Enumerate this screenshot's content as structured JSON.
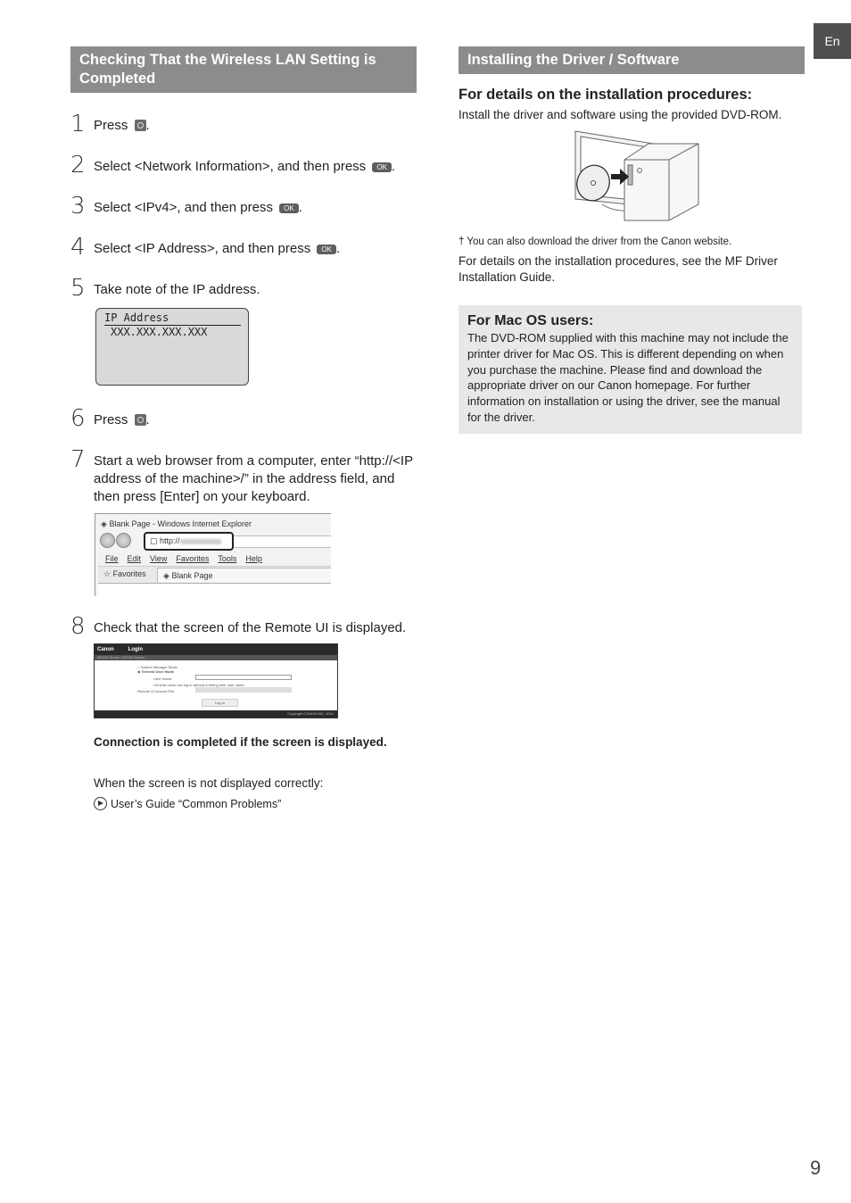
{
  "lang_tab": "En",
  "page_number": "9",
  "left": {
    "header": "Checking That the Wireless LAN Setting is Completed",
    "steps": [
      {
        "num": "1",
        "pre": "Press",
        "post": ".",
        "button": "home-button"
      },
      {
        "num": "2",
        "pre": "Select <Network Information>, and then press",
        "post": ".",
        "button": "OK"
      },
      {
        "num": "3",
        "pre": "Select <IPv4>, and then press",
        "post": ".",
        "button": "OK"
      },
      {
        "num": "4",
        "pre": "Select <IP Address>, and then press",
        "post": ".",
        "button": "OK"
      },
      {
        "num": "5",
        "text": "Take note of the IP address."
      },
      {
        "num": "6",
        "pre": "Press",
        "post": ".",
        "button": "home-button"
      },
      {
        "num": "7",
        "text": "Start a web browser from a computer, enter “http://<IP address of the machine>/” in the address field, and then press [Enter] on your keyboard."
      },
      {
        "num": "8",
        "text": "Check that the screen of the Remote UI is displayed."
      }
    ],
    "ok_label": "OK",
    "lcd": {
      "title": "IP Address",
      "value": "XXX.XXX.XXX.XXX"
    },
    "browser": {
      "title": "Blank Page - Windows Internet Explorer",
      "address": "http://",
      "menu": [
        "File",
        "Edit",
        "View",
        "Favorites",
        "Tools",
        "Help"
      ],
      "favorites": "Favorites",
      "tab": "Blank Page"
    },
    "remote_ui": {
      "brand": "Canon",
      "title": "Login",
      "crumb": "MF240 Series / MF240 Series /",
      "mode1": "System Manager Mode",
      "mode2": "General User Mode",
      "user_name_label": "User Name:",
      "note": "General users can log in without entering their user name.",
      "pin_label": "Remote UI Access PIN:",
      "login_button": "Log In",
      "copyright": "Copyright CANON INC. 2014"
    },
    "bold_note": "Connection is completed if the screen is displayed.",
    "plain_note": "When the screen is not displayed correctly:",
    "reference": "User’s Guide “Common Problems”"
  },
  "right": {
    "header": "Installing the Driver / Software",
    "sub_heading": "For details on the installation procedures:",
    "intro": "Install the driver and software using the provided DVD-ROM.",
    "footnote": "† You can also download the driver from the Canon website.",
    "details": "For details on the installation procedures, see the MF Driver Installation Guide.",
    "mac": {
      "title": "For Mac OS users:",
      "body": "The DVD-ROM supplied with this machine may not include the printer driver for Mac OS. This is different depending on when you purchase the machine. Please find and download the appropriate driver on our Canon homepage. For further information on installation or using the driver, see the manual for the driver."
    }
  }
}
